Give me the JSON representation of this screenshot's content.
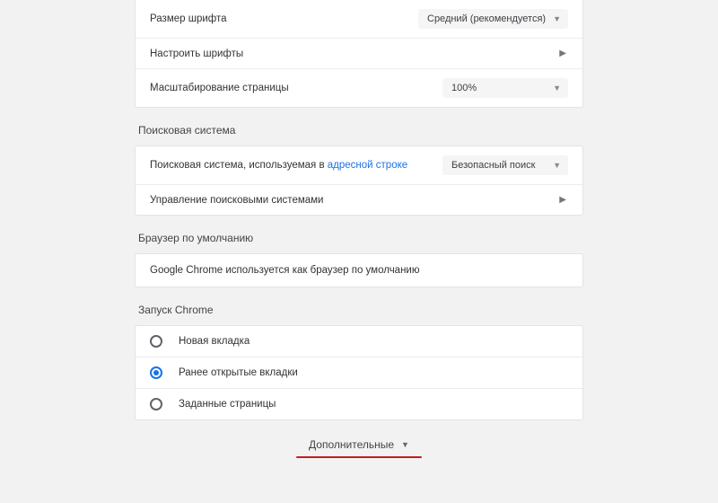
{
  "appearance": {
    "font_size_label": "Размер шрифта",
    "font_size_value": "Средний (рекомендуется)",
    "customize_fonts_label": "Настроить шрифты",
    "page_zoom_label": "Масштабирование страницы",
    "page_zoom_value": "100%"
  },
  "search_engine": {
    "title": "Поисковая система",
    "row1_prefix": "Поисковая система, используемая в ",
    "row1_link": "адресной строке",
    "selected_engine": "Безопасный поиск",
    "manage_label": "Управление поисковыми системами"
  },
  "default_browser": {
    "title": "Браузер по умолчанию",
    "info": "Google Chrome используется как браузер по умолчанию"
  },
  "on_startup": {
    "title": "Запуск Chrome",
    "options": [
      {
        "label": "Новая вкладка",
        "selected": false
      },
      {
        "label": "Ранее открытые вкладки",
        "selected": true
      },
      {
        "label": "Заданные страницы",
        "selected": false
      }
    ]
  },
  "advanced_label": "Дополнительные"
}
